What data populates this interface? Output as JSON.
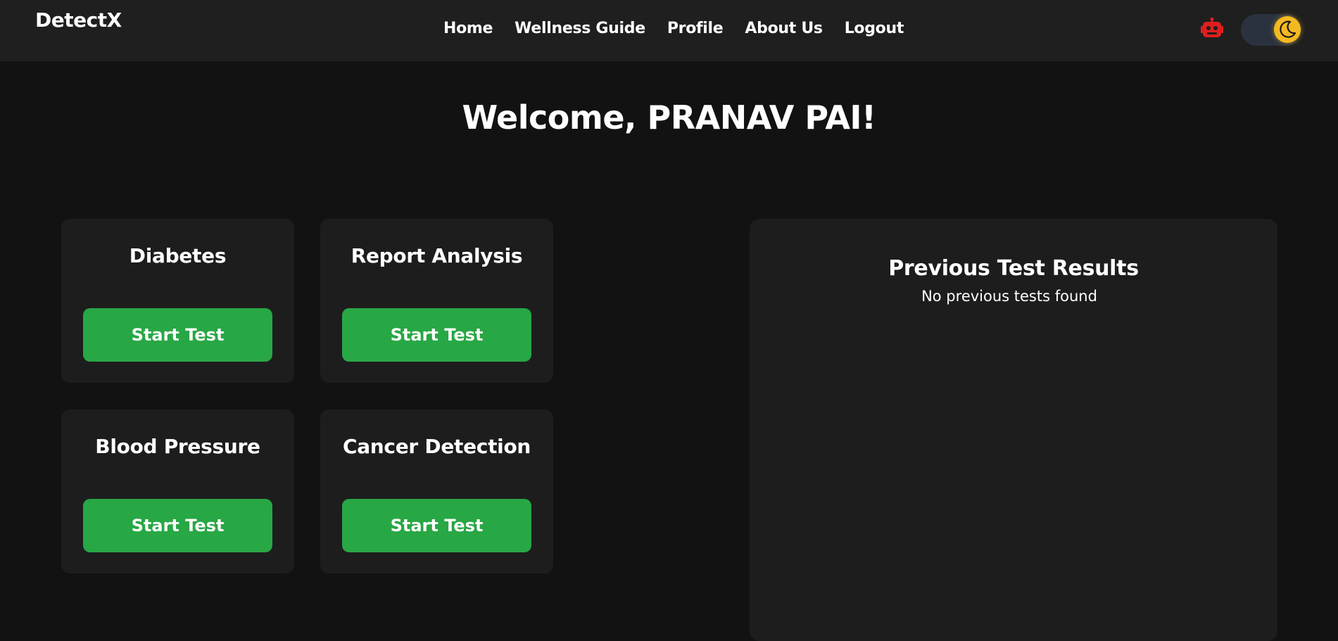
{
  "app": {
    "brand": "DetectX"
  },
  "nav": {
    "links": [
      {
        "label": "Home"
      },
      {
        "label": "Wellness Guide"
      },
      {
        "label": "Profile"
      },
      {
        "label": "About Us"
      },
      {
        "label": "Logout"
      }
    ],
    "chatbot_icon": "robot-icon",
    "theme_toggle": {
      "icon": "moon-icon",
      "mode": "dark"
    }
  },
  "welcome": {
    "text": "Welcome, PRANAV PAI!"
  },
  "tests": [
    {
      "title": "Diabetes",
      "button": "Start Test"
    },
    {
      "title": "Report Analysis",
      "button": "Start Test"
    },
    {
      "title": "Blood Pressure",
      "button": "Start Test"
    },
    {
      "title": "Cancer Detection",
      "button": "Start Test"
    }
  ],
  "results": {
    "title": "Previous Test Results",
    "empty_message": "No previous tests found"
  },
  "colors": {
    "background": "#121212",
    "navbar": "#1f1f1f",
    "card": "#1d1d1d",
    "accent_green": "#28a745",
    "robot_red": "#e01e1e",
    "moon_yellow": "#f4b920"
  }
}
